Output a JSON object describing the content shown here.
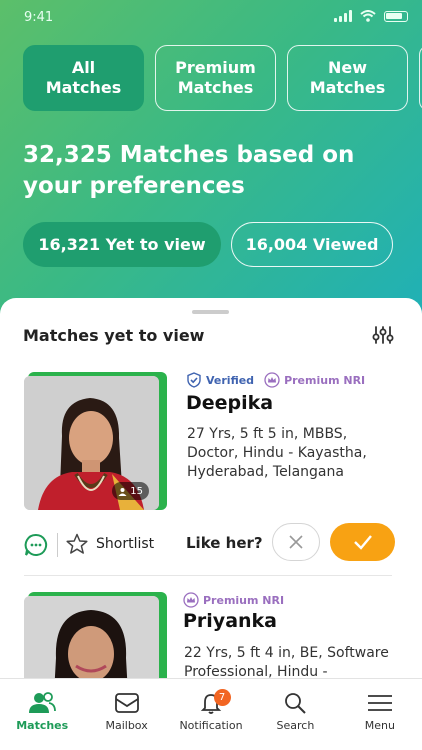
{
  "status_bar": {
    "time": "9:41"
  },
  "tabs": [
    {
      "label": "All\nMatches",
      "active": true
    },
    {
      "label": "Premium\nMatches",
      "active": false
    },
    {
      "label": "New\nMatches",
      "active": false
    }
  ],
  "headline": "32,325 Matches based on your preferences",
  "pills": {
    "yet_to_view": "16,321 Yet to view",
    "viewed": "16,004 Viewed"
  },
  "sheet": {
    "title": "Matches yet to view"
  },
  "profiles": [
    {
      "verified_label": "Verified",
      "premium_label": "Premium NRI",
      "name": "Deepika",
      "details": "27 Yrs, 5 ft 5 in, MBBS, Doctor, Hindu - Kayastha, Hyderabad, Telangana",
      "photo_count": "15"
    },
    {
      "premium_label": "Premium NRI",
      "name": "Priyanka",
      "details": "22 Yrs, 5 ft 4 in, BE, Software Professional, Hindu -"
    }
  ],
  "actions": {
    "shortlist_label": "Shortlist",
    "like_label": "Like her?"
  },
  "nav": {
    "matches": "Matches",
    "mailbox": "Mailbox",
    "notification": "Notification",
    "notification_count": "7",
    "search": "Search",
    "menu": "Menu"
  },
  "colors": {
    "accent_green": "#1f9e6f",
    "like_orange": "#f8a213",
    "badge_orange": "#f26522"
  }
}
